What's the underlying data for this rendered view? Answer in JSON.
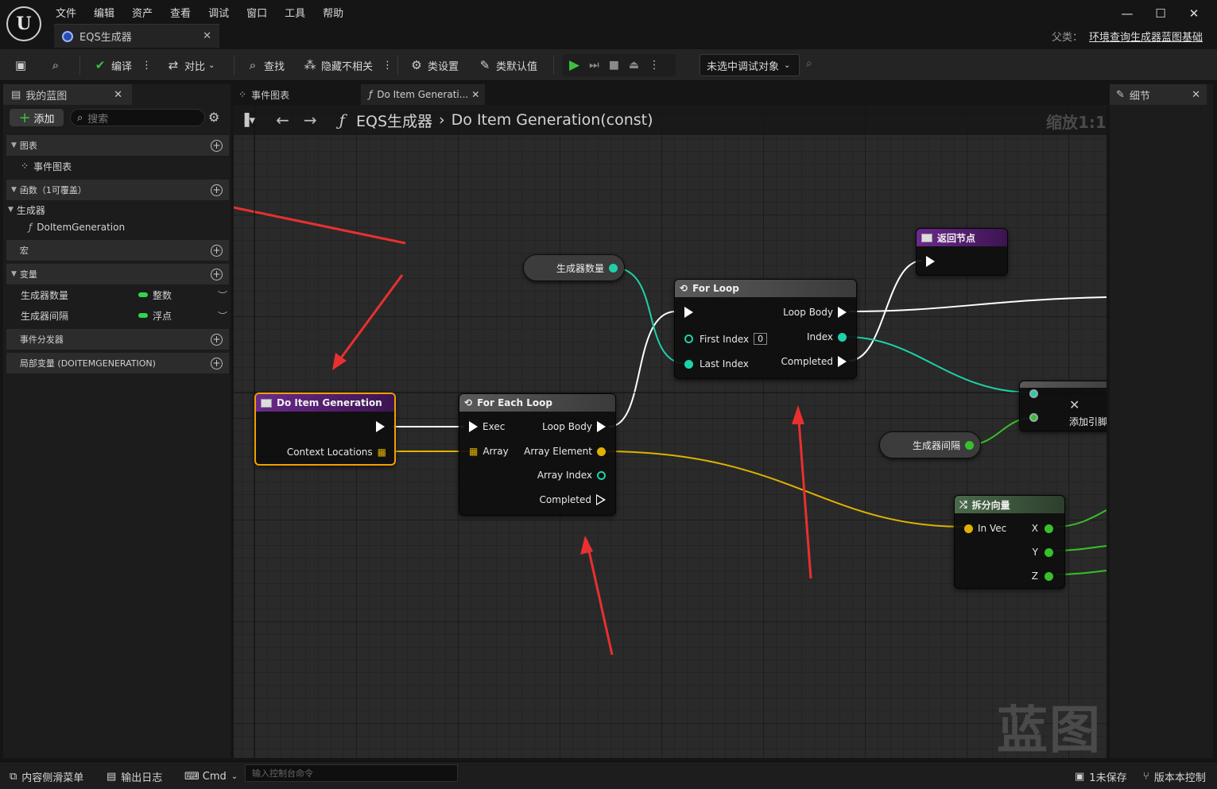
{
  "app": {
    "logo": "U",
    "menu": [
      "文件",
      "编辑",
      "资产",
      "查看",
      "调试",
      "窗口",
      "工具",
      "帮助"
    ],
    "document_tab": "EQS生成器",
    "parent_label": "父类：",
    "parent_value": "环境查询生成器蓝图基础",
    "window_controls": [
      "—",
      "☐",
      "✕"
    ]
  },
  "toolbar": {
    "compile": "编译",
    "diff": "对比",
    "find": "查找",
    "hide_unrelated": "隐藏不相关",
    "class_settings": "类设置",
    "class_defaults": "类默认值",
    "debug_object": "未选中调试对象"
  },
  "my_blueprint": {
    "tab": "我的蓝图",
    "add": "添加",
    "search_placeholder": "搜索",
    "sections": {
      "graphs": "图表",
      "functions": "函数（1可覆盖）",
      "macros": "宏",
      "variables": "变量",
      "dispatchers": "事件分发器",
      "local_vars": "局部变量 (DOITEMGENERATION)"
    },
    "graph_items": [
      "事件图表"
    ],
    "generator_group": "生成器",
    "function_items": [
      "DoItemGeneration"
    ],
    "variables": [
      {
        "name": "生成器数量",
        "type": "整数"
      },
      {
        "name": "生成器间隔",
        "type": "浮点"
      }
    ]
  },
  "graph": {
    "tabs": [
      "事件图表",
      "Do Item Generati..."
    ],
    "breadcrumb": [
      "EQS生成器",
      "Do Item Generation(const)"
    ],
    "zoom": "缩放1:1",
    "watermark": "蓝图",
    "nodes": {
      "entry": {
        "title": "Do Item Generation",
        "pin_out": "Context Locations"
      },
      "foreach": {
        "title": "For Each Loop",
        "exec": "Exec",
        "array": "Array",
        "loop_body": "Loop Body",
        "element": "Array Element",
        "index": "Array Index",
        "completed": "Completed"
      },
      "forloop": {
        "title": "For Loop",
        "first_index": "First Index",
        "first_index_value": "0",
        "last_index": "Last Index",
        "loop_body": "Loop Body",
        "index": "Index",
        "completed": "Completed"
      },
      "return": {
        "title": "返回节点"
      },
      "get_count": {
        "label": "生成器数量"
      },
      "get_spacing": {
        "label": "生成器间隔"
      },
      "break_vec": {
        "title": "拆分向量",
        "in": "In Vec",
        "x": "X",
        "y": "Y",
        "z": "Z"
      },
      "add_pin": {
        "label": "添加引脚"
      }
    }
  },
  "details": {
    "tab": "细节"
  },
  "bottom": {
    "content_drawer": "内容侧滑菜单",
    "output_log": "输出日志",
    "cmd": "Cmd",
    "console_placeholder": "输入控制台命令",
    "unsaved": "1未保存",
    "source_control": "版本本控制"
  },
  "colors": {
    "exec_wire": "#ffffff",
    "int_wire": "#1fd1a8",
    "float_wire": "#38c02a",
    "vector_wire": "#e0b100",
    "arrow_annotation": "#e83030"
  }
}
